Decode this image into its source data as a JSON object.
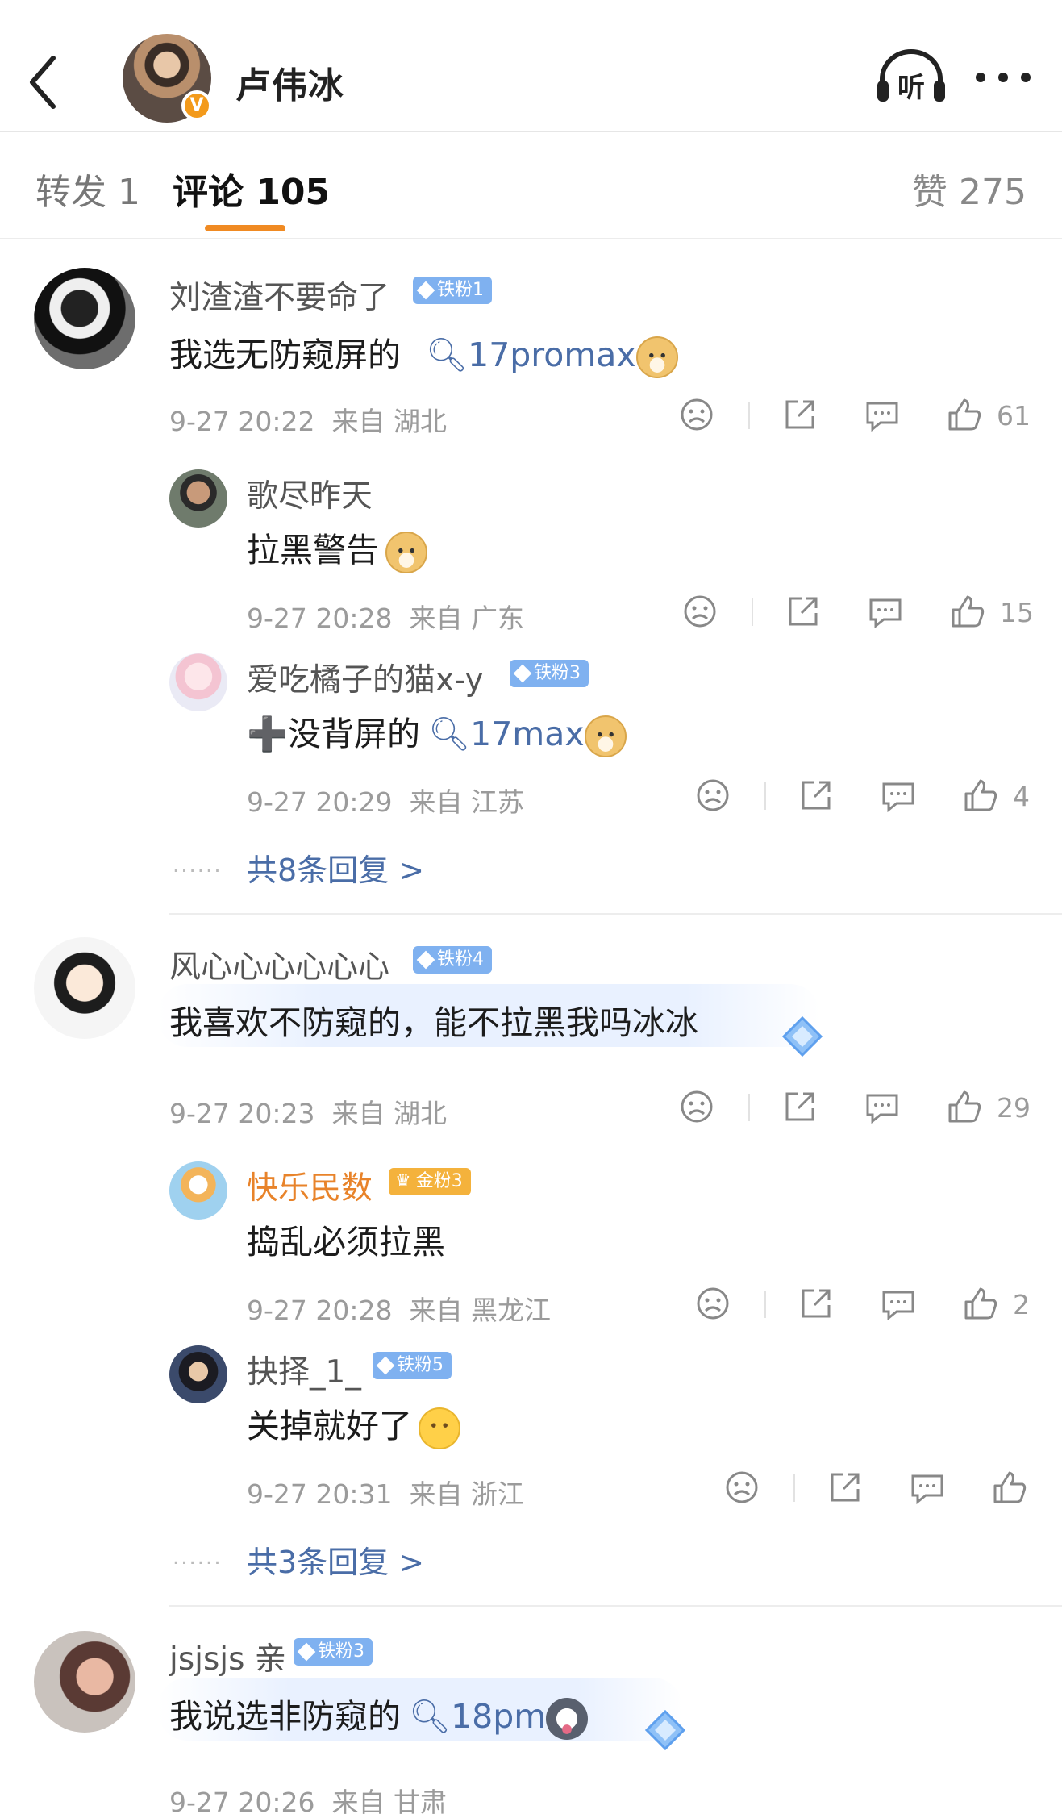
{
  "header": {
    "author_name": "卢伟冰",
    "verified_badge": "V",
    "listen_label": "听"
  },
  "tabs": {
    "repost": "转发 1",
    "comments": "评论 105",
    "likes": "赞 275"
  },
  "comments": [
    {
      "user": "刘渣渣不要命了",
      "badge": "铁粉1",
      "text_prefix": "我选无防窥屏的",
      "search_term": "17promax",
      "time": "9-27 20:22",
      "location": "来自 湖北",
      "likes": "61",
      "replies": [
        {
          "user": "歌尽昨天",
          "badge": "",
          "text_prefix": "拉黑警告",
          "search_term": "",
          "time": "9-27 20:28",
          "location": "来自 广东",
          "likes": "15"
        },
        {
          "user": "爱吃橘子的猫x-y",
          "badge": "铁粉3",
          "text_prefix": "➕没背屏的",
          "search_term": "17max",
          "time": "9-27 20:29",
          "location": "来自 江苏",
          "likes": "4"
        }
      ],
      "more_replies": "共8条回复 >"
    },
    {
      "user": "风心心心心心心",
      "badge": "铁粉4",
      "text_prefix": "我喜欢不防窥的，能不拉黑我吗冰冰",
      "search_term": "",
      "time": "9-27 20:23",
      "location": "来自 湖北",
      "likes": "29",
      "replies": [
        {
          "user": "快乐民数",
          "badge": "金粉3",
          "text_prefix": "捣乱必须拉黑",
          "search_term": "",
          "time": "9-27 20:28",
          "location": "来自 黑龙江",
          "likes": "2"
        },
        {
          "user": "抉择_1_",
          "badge": "铁粉5",
          "text_prefix": "关掉就好了",
          "search_term": "",
          "time": "9-27 20:31",
          "location": "来自 浙江",
          "likes": ""
        }
      ],
      "more_replies": "共3条回复 >"
    },
    {
      "user": "jsjsjs 亲",
      "badge": "铁粉3",
      "text_prefix": "我说选非防窥的",
      "search_term": "18pm",
      "time": "9-27 20:26",
      "location": "来自 甘肃",
      "likes": ""
    }
  ],
  "dots": "......",
  "colors": {
    "accent_orange": "#f08a22",
    "link_blue": "#4a6da7",
    "iron_badge": "#7fb1f0",
    "gold_badge": "#f4b23c"
  }
}
